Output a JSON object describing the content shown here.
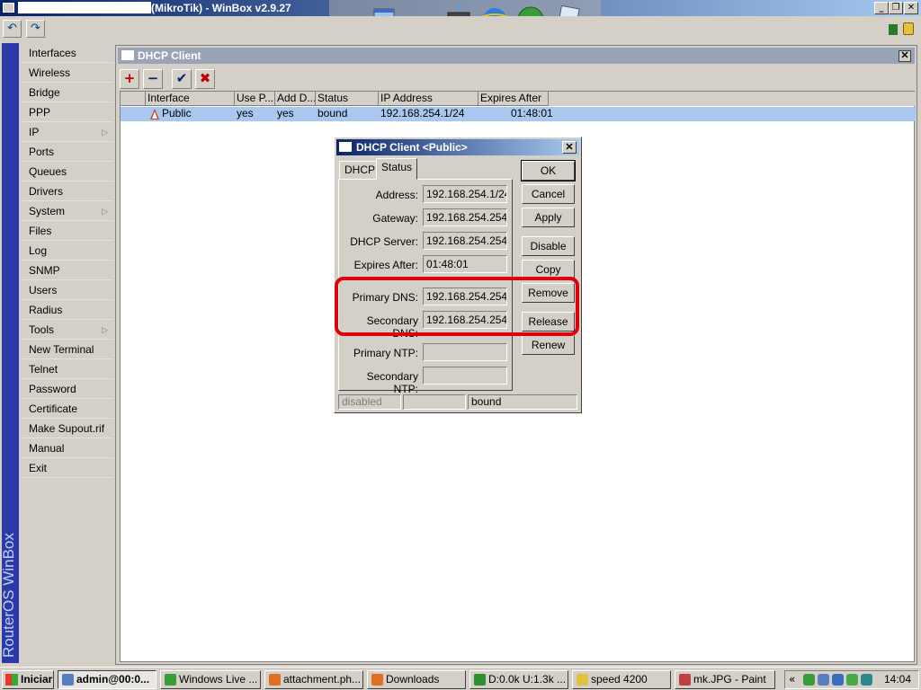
{
  "app": {
    "title": "(MikroTik) - WinBox v2.9.27",
    "brand": "RouterOS WinBox"
  },
  "menu": [
    {
      "label": "Interfaces",
      "submenu": false
    },
    {
      "label": "Wireless",
      "submenu": false
    },
    {
      "label": "Bridge",
      "submenu": false
    },
    {
      "label": "PPP",
      "submenu": false
    },
    {
      "label": "IP",
      "submenu": true
    },
    {
      "label": "Ports",
      "submenu": false
    },
    {
      "label": "Queues",
      "submenu": false
    },
    {
      "label": "Drivers",
      "submenu": false
    },
    {
      "label": "System",
      "submenu": true
    },
    {
      "label": "Files",
      "submenu": false
    },
    {
      "label": "Log",
      "submenu": false
    },
    {
      "label": "SNMP",
      "submenu": false
    },
    {
      "label": "Users",
      "submenu": false
    },
    {
      "label": "Radius",
      "submenu": false
    },
    {
      "label": "Tools",
      "submenu": true
    },
    {
      "label": "New Terminal",
      "submenu": false
    },
    {
      "label": "Telnet",
      "submenu": false
    },
    {
      "label": "Password",
      "submenu": false
    },
    {
      "label": "Certificate",
      "submenu": false
    },
    {
      "label": "Make Supout.rif",
      "submenu": false
    },
    {
      "label": "Manual",
      "submenu": false
    },
    {
      "label": "Exit",
      "submenu": false
    }
  ],
  "dhcp_window": {
    "title": "DHCP Client",
    "toolbar": {
      "add": "+",
      "remove": "−",
      "enable": "✔",
      "disable": "✖"
    },
    "columns": [
      "Interface",
      "Use P...",
      "Add D...",
      "Status",
      "IP Address",
      "Expires After"
    ],
    "rows": [
      {
        "interface": "Public",
        "use_peer": "yes",
        "add_default": "yes",
        "status": "bound",
        "ip": "192.168.254.1/24",
        "expires": "01:48:01"
      }
    ]
  },
  "dialog": {
    "title": "DHCP Client <Public>",
    "tabs": [
      "DHCP",
      "Status"
    ],
    "active_tab": "Status",
    "fields": [
      {
        "label": "Address:",
        "value": "192.168.254.1/24"
      },
      {
        "label": "Gateway:",
        "value": "192.168.254.254"
      },
      {
        "label": "DHCP Server:",
        "value": "192.168.254.254"
      },
      {
        "label": "Expires After:",
        "value": "01:48:01"
      },
      {
        "label": "Primary DNS:",
        "value": "192.168.254.254"
      },
      {
        "label": "Secondary DNS:",
        "value": "192.168.254.254"
      },
      {
        "label": "Primary NTP:",
        "value": ""
      },
      {
        "label": "Secondary NTP:",
        "value": ""
      }
    ],
    "buttons": [
      "OK",
      "Cancel",
      "Apply",
      "Disable",
      "Copy",
      "Remove",
      "Release",
      "Renew"
    ],
    "status_bar": [
      "disabled",
      "",
      "bound"
    ]
  },
  "taskbar": {
    "start": "Iniciar",
    "tasks": [
      {
        "label": "admin@00:0...",
        "active": true,
        "color": "#5a7dbf"
      },
      {
        "label": "Windows Live ...",
        "active": false,
        "color": "#3a9b3a"
      },
      {
        "label": "attachment.ph...",
        "active": false,
        "color": "#e07020"
      },
      {
        "label": "Downloads",
        "active": false,
        "color": "#e07020"
      },
      {
        "label": "D:0.0k U:1.3k ...",
        "active": false,
        "color": "#2f8f2f"
      },
      {
        "label": "speed 4200",
        "active": false,
        "color": "#e2c040"
      },
      {
        "label": "mk.JPG - Paint",
        "active": false,
        "color": "#c04040"
      }
    ],
    "clock": "14:04",
    "tray_arrow": "«"
  },
  "colors": {
    "accent_red": "#e0000a",
    "brand_bar": "#2a3aa8",
    "row_selected": "#a8c8f0"
  }
}
